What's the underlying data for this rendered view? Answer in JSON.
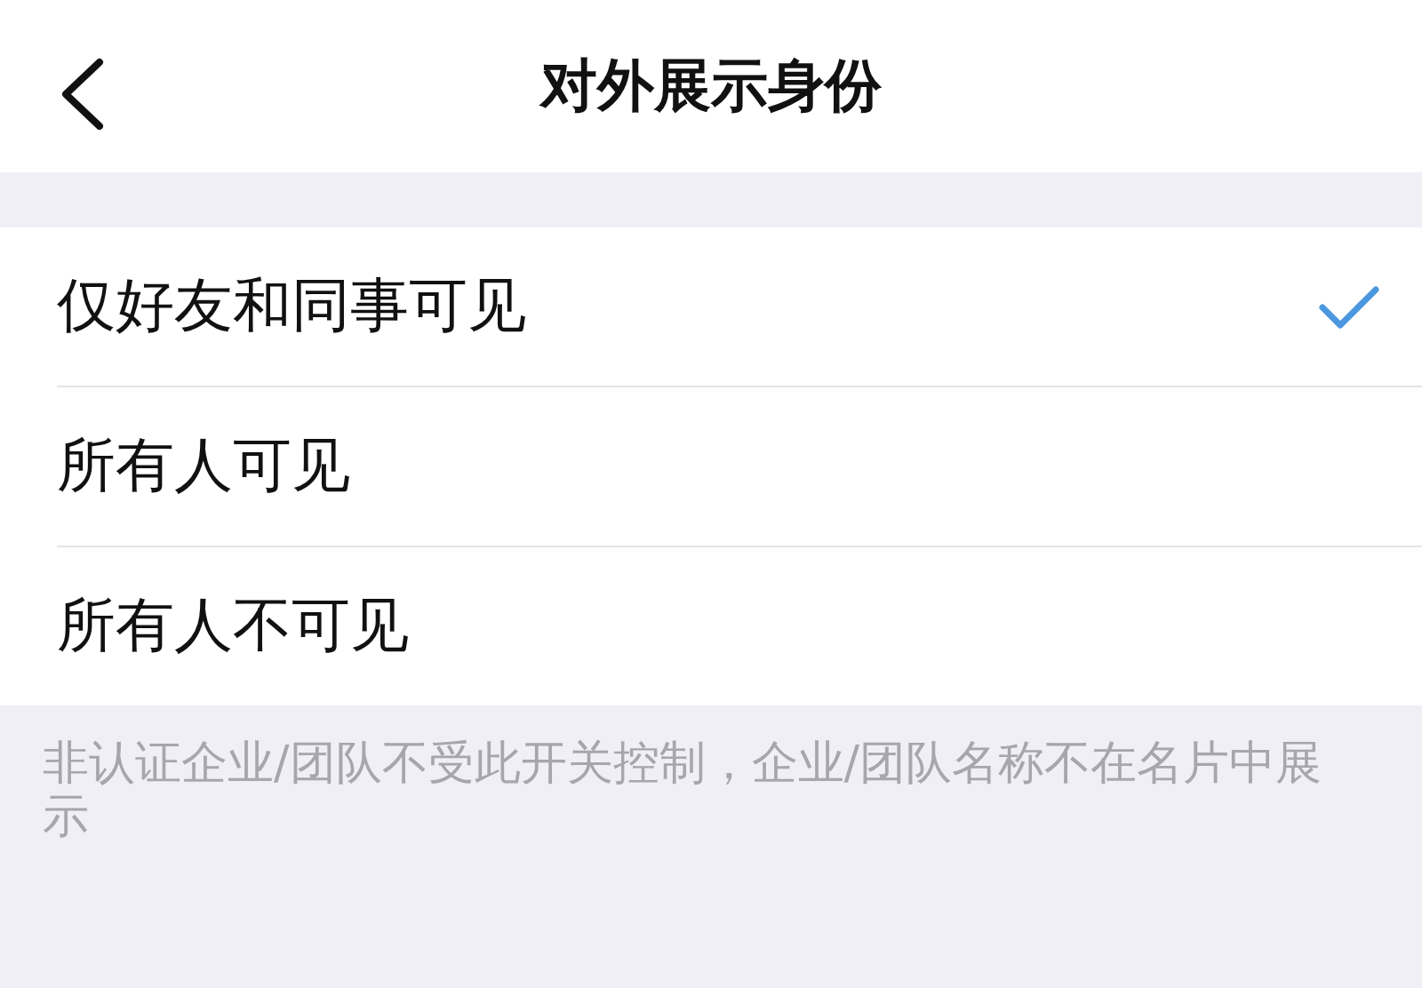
{
  "header": {
    "title": "对外展示身份"
  },
  "options": [
    {
      "label": "仅好友和同事可见",
      "selected": true
    },
    {
      "label": "所有人可见",
      "selected": false
    },
    {
      "label": "所有人不可见",
      "selected": false
    }
  ],
  "note": "非认证企业/团队不受此开关控制，企业/团队名称不在名片中展示"
}
